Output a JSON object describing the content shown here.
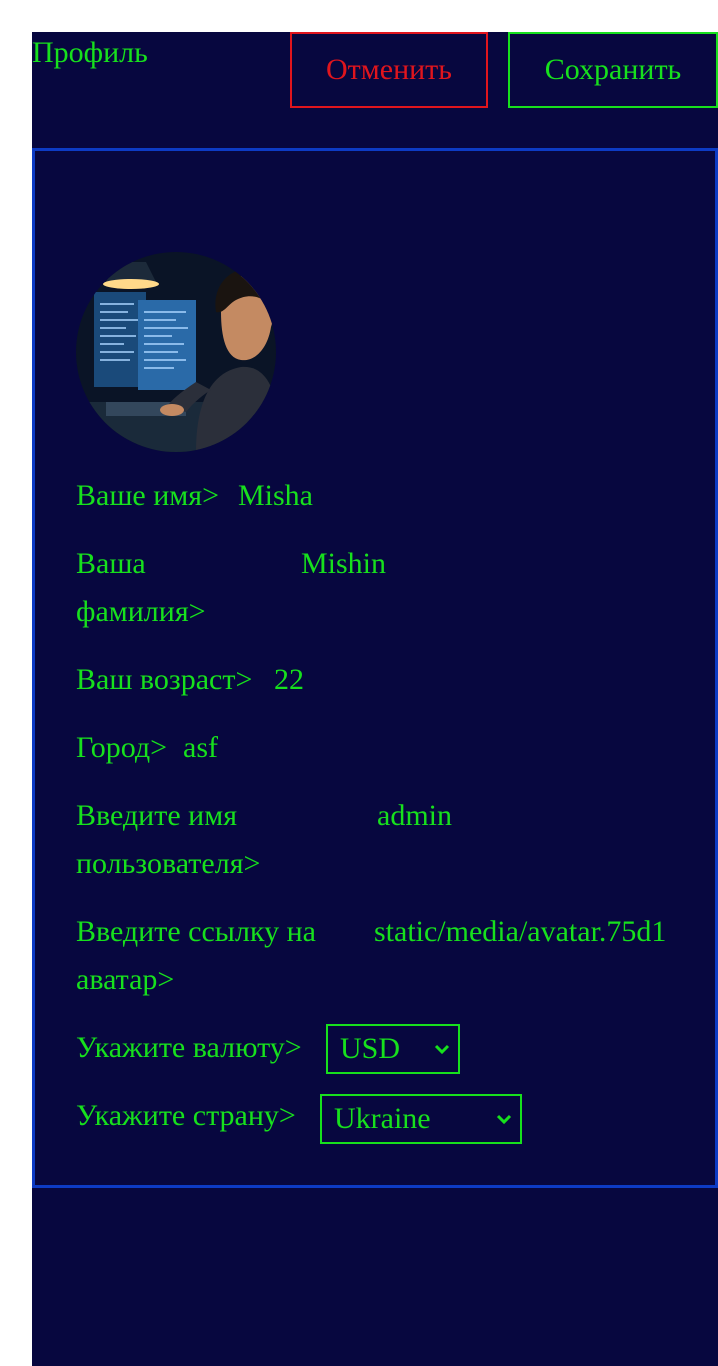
{
  "header": {
    "title": "Профиль",
    "cancel_label": "Отменить",
    "save_label": "Сохранить"
  },
  "profile": {
    "avatar_icon": "avatar-image",
    "fields": [
      {
        "label_line1": "Ваше имя>",
        "label_line2": "",
        "value": "Misha"
      },
      {
        "label_line1": "Ваша",
        "label_line2": "фамилия>",
        "value": "Mishin"
      },
      {
        "label_line1": "Ваш возраст>",
        "label_line2": "",
        "value": "22"
      },
      {
        "label_line1": "Город>",
        "label_line2": "",
        "value": "asf"
      },
      {
        "label_line1": "Введите имя",
        "label_line2": "пользователя>",
        "value": "admin"
      },
      {
        "label_line1": "Введите ссылку на",
        "label_line2": "аватар>",
        "value": "static/media/avatar.75d1"
      }
    ],
    "currency": {
      "label": "Укажите валюту>",
      "selected": "USD"
    },
    "country": {
      "label": "Укажите страну>",
      "selected": "Ukraine"
    }
  },
  "colors": {
    "background": "#07073f",
    "text": "#17e01d",
    "cancel": "#e0151d",
    "card_border": "#0d3bc4"
  }
}
